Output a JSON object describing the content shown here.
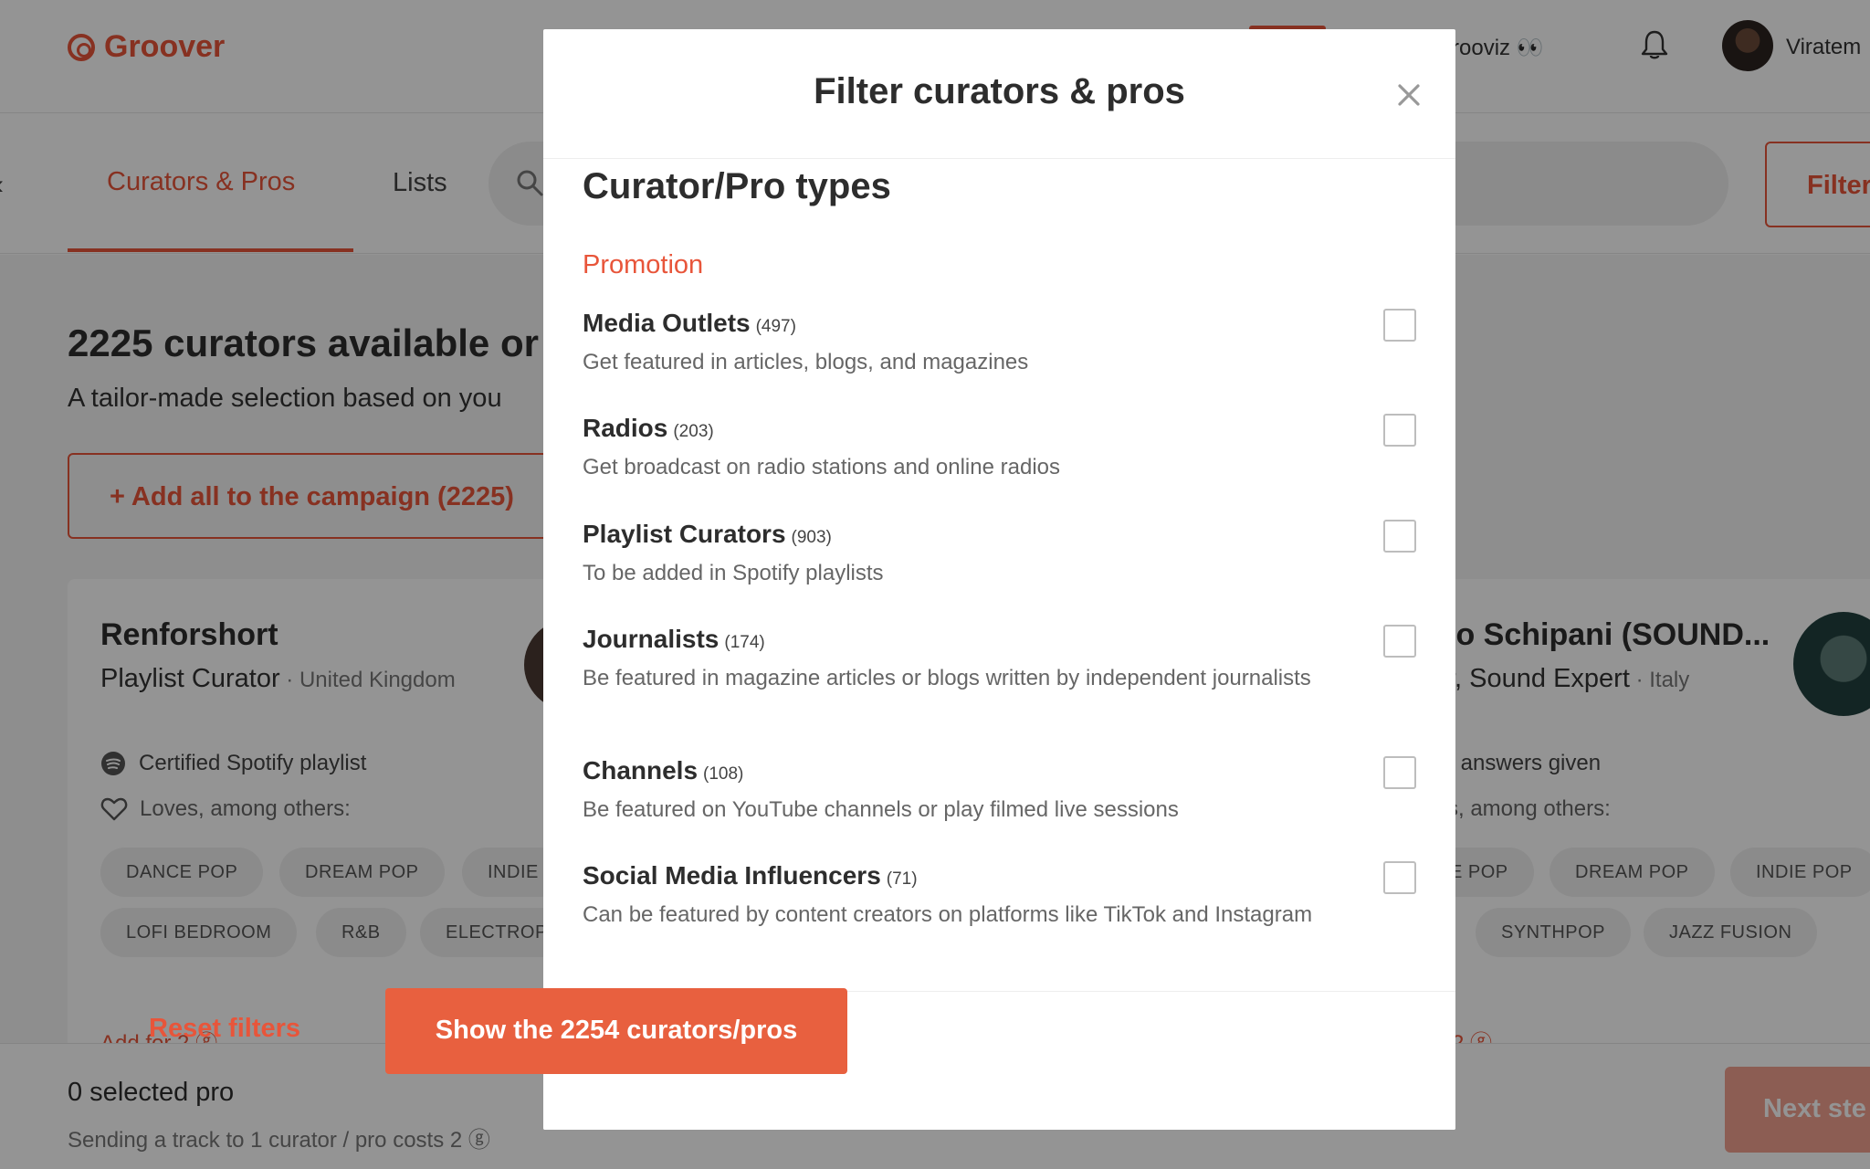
{
  "app": {
    "logo_text": "Groover",
    "user_partial": "rooviz 👀",
    "username": "Viratem"
  },
  "nav": {
    "tab_curators": "Curators & Pros",
    "tab_lists": "Lists",
    "filter_label": "Filter"
  },
  "main": {
    "headline": "2225 curators available or",
    "subhead": "A tailor-made selection based on you",
    "add_all": "+ Add all to the campaign (2225)"
  },
  "cards": {
    "left": {
      "name": "Renforshort",
      "role": "Playlist Curator",
      "country": " · United Kingdom",
      "line1": "Certified Spotify playlist",
      "line2": "Loves, among others:",
      "tags": [
        "DANCE POP",
        "DREAM POP",
        "INDIE",
        "LOFI BEDROOM",
        "R&B",
        "ELECTROP"
      ],
      "add_for": "Add for 2 ⓖ"
    },
    "right": {
      "name": "io Schipani (SOUND...",
      "role": "r, Sound Expert",
      "country": " · Italy",
      "line1": ") answers given",
      "line2": "s, among others:",
      "tags": [
        "E POP",
        "DREAM POP",
        "INDIE POP",
        "SYNTHPOP",
        "JAZZ FUSION"
      ],
      "add_for": "2 ⓖ"
    }
  },
  "bottom": {
    "selected": "0 selected pro",
    "costs": "Sending a track to 1 curator / pro costs 2 ⓖ",
    "next": "Next ste"
  },
  "modal": {
    "title": "Filter curators & pros",
    "section_title": "Curator/Pro types",
    "group_title": "Promotion",
    "options": [
      {
        "name": "Media Outlets",
        "count": "(497)",
        "desc": "Get featured in articles, blogs, and magazines",
        "checked": false
      },
      {
        "name": "Radios",
        "count": "(203)",
        "desc": "Get broadcast on radio stations and online radios",
        "checked": false
      },
      {
        "name": "Playlist Curators",
        "count": "(903)",
        "desc": "To be added in Spotify playlists",
        "checked": false
      },
      {
        "name": "Journalists",
        "count": "(174)",
        "desc": "Be featured in magazine articles or blogs written by independent journalists",
        "checked": false
      },
      {
        "name": "Channels",
        "count": "(108)",
        "desc": "Be featured on YouTube channels or play filmed live sessions",
        "checked": false
      },
      {
        "name": "Social Media Influencers",
        "count": "(71)",
        "desc": "Can be featured by content creators on platforms like TikTok and Instagram",
        "checked": false
      }
    ],
    "reset_label": "Reset filters",
    "show_label": "Show the 2254 curators/pros"
  },
  "colors": {
    "accent": "#e8553a",
    "button": "#e8603f",
    "overlay": "rgba(0,0,0,0.42)"
  }
}
